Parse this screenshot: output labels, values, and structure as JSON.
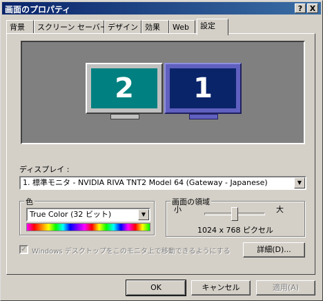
{
  "window": {
    "title": "画面のプロパティ",
    "help_label": "?",
    "close_label": "X"
  },
  "tabs": [
    {
      "label": "背景"
    },
    {
      "label": "スクリーン セーバー"
    },
    {
      "label": "デザイン"
    },
    {
      "label": "効果"
    },
    {
      "label": "Web"
    },
    {
      "label": "設定"
    }
  ],
  "monitors": [
    {
      "number": "2",
      "screen_color": "#008080"
    },
    {
      "number": "1",
      "screen_color": "#0a246a"
    }
  ],
  "display": {
    "label": "ディスプレイ :",
    "value": "1. 標準モニタ - NVIDIA RIVA TNT2 Model 64 (Gateway - Japanese)"
  },
  "color": {
    "group_title": "色",
    "value": "True Color (32 ビット)"
  },
  "resolution": {
    "group_title": "画面の領域",
    "min_label": "小",
    "max_label": "大",
    "value_text": "1024 x 768 ピクセル",
    "level": 0.5
  },
  "extend_desktop": {
    "label": "Windows デスクトップをこのモニタ上で移動できるようにする",
    "checked": true
  },
  "advanced_button": "詳細(D)...",
  "footer": {
    "ok": "OK",
    "cancel": "キャンセル",
    "apply": "適用(A)"
  }
}
